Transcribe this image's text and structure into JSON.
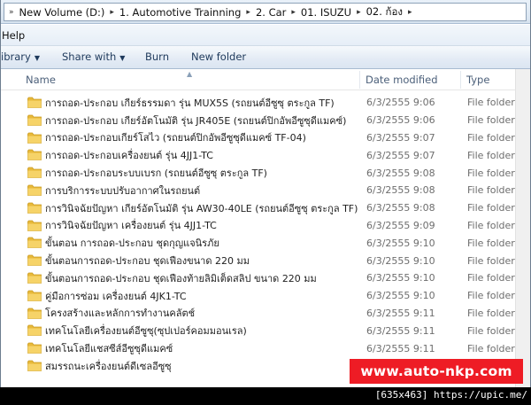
{
  "address": {
    "crumbs": [
      "New Volume (D:)",
      "1. Automotive Trainning",
      "2. Car",
      "01. ISUZU",
      "02. ก้อง"
    ]
  },
  "menubar": {
    "items": [
      "Help"
    ]
  },
  "toolbar": {
    "library_label": "ibrary",
    "share_label": "Share with",
    "burn_label": "Burn",
    "new_folder_label": "New folder"
  },
  "columns": {
    "name": "Name",
    "date": "Date modified",
    "type": "Type"
  },
  "files": [
    {
      "name": "การถอด-ประกอบ เกียร์ธรรมดา รุ่น MUX5S (รถยนต์อีซูซุ ตระกูล TF)",
      "date": "6/3/2555 9:06",
      "type": "File folder"
    },
    {
      "name": "การถอด-ประกอบ เกียร์อัตโนมัติ รุ่น JR405E (รถยนต์ปิกอัพอีซูซุดีแมคซ์)",
      "date": "6/3/2555 9:06",
      "type": "File folder"
    },
    {
      "name": "การถอด-ประกอบเกียร์โสไว (รถยนต์ปิกอัพอีซูซุดีแมคซ์ TF-04)",
      "date": "6/3/2555 9:07",
      "type": "File folder"
    },
    {
      "name": "การถอด-ประกอบเครื่องยนต์ รุ่น 4JJ1-TC",
      "date": "6/3/2555 9:07",
      "type": "File folder"
    },
    {
      "name": "การถอด-ประกอบระบบเบรก (รถยนต์อีซูซุ ตระกูล TF)",
      "date": "6/3/2555 9:08",
      "type": "File folder"
    },
    {
      "name": "การบริการระบบปรับอากาศในรถยนต์",
      "date": "6/3/2555 9:08",
      "type": "File folder"
    },
    {
      "name": "การวินิจฉัยปัญหา เกียร์อัตโนมัติ รุ่น AW30-40LE (รถยนต์อีซูซุ ตระกูล TF)",
      "date": "6/3/2555 9:08",
      "type": "File folder"
    },
    {
      "name": "การวินิจฉัยปัญหา เครื่องยนต์ รุ่น 4JJ1-TC",
      "date": "6/3/2555 9:09",
      "type": "File folder"
    },
    {
      "name": "ขั้นตอน การถอด-ประกอบ ชุดกุญแจนิรภัย",
      "date": "6/3/2555 9:10",
      "type": "File folder"
    },
    {
      "name": "ขั้นตอนการถอด-ประกอบ ชุดเฟืองขนาด 220 มม",
      "date": "6/3/2555 9:10",
      "type": "File folder"
    },
    {
      "name": "ขั้นตอนการถอด-ประกอบ ชุดเฟืองท้ายลิมิเต็ดสลิป ขนาด 220 มม",
      "date": "6/3/2555 9:10",
      "type": "File folder"
    },
    {
      "name": "คู่มือการซ่อม เครื่องยนต์ 4JK1-TC",
      "date": "6/3/2555 9:10",
      "type": "File folder"
    },
    {
      "name": "โครงสร้างและหลักการทำงานคลัตช์",
      "date": "6/3/2555 9:11",
      "type": "File folder"
    },
    {
      "name": "เทคโนโลยีเครื่องยนต์อีซูซุ(ซุปเปอร์คอมมอนเรล)",
      "date": "6/3/2555 9:11",
      "type": "File folder"
    },
    {
      "name": "เทคโนโลยีแชสซีส์อีซูซุดีแมคซ์",
      "date": "6/3/2555 9:11",
      "type": "File folder"
    },
    {
      "name": "สมรรถนะเครื่องยนต์ดีเซลอีซูซุ",
      "date": "",
      "type": ""
    }
  ],
  "watermark": "www.auto-nkp.com",
  "footer_note": "[635x463] https://upic.me/",
  "colors": {
    "accent": "#ee1c25",
    "folder": "#f2c94c",
    "header_text": "#4c607a"
  }
}
